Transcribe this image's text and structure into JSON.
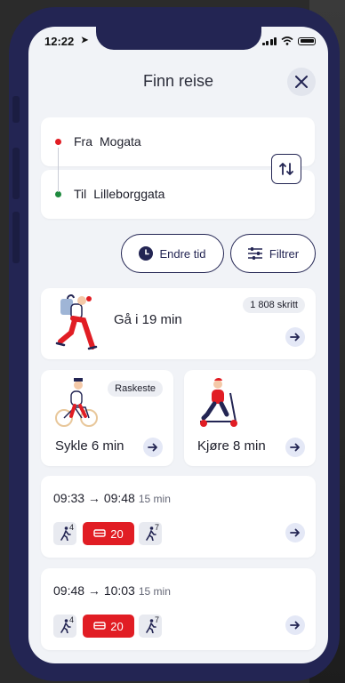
{
  "status": {
    "time": "12:22"
  },
  "header": {
    "title": "Finn reise"
  },
  "search": {
    "from_label": "Fra",
    "from_value": "Mogata",
    "to_label": "Til",
    "to_value": "Lilleborggata"
  },
  "actions": {
    "time_label": "Endre tid",
    "filter_label": "Filtrer"
  },
  "walk": {
    "label": "Gå i 19 min",
    "steps": "1 808 skritt"
  },
  "bike": {
    "label": "Sykle 6 min",
    "badge": "Raskeste"
  },
  "scooter": {
    "label": "Kjøre 8 min"
  },
  "trips": [
    {
      "time": "09:33 → 09:48",
      "duration": "15 min",
      "walk1": "4",
      "bus": "20",
      "walk2": "7"
    },
    {
      "time": "09:48 → 10:03",
      "duration": "15 min",
      "walk1": "4",
      "bus": "20",
      "walk2": "7"
    }
  ],
  "colors": {
    "navy": "#232553",
    "bus_red": "#e11d24",
    "from_dot": "#e11d24",
    "to_dot": "#1e8a3e",
    "card_bg": "#ffffff",
    "screen_bg": "#f1f3f7"
  }
}
